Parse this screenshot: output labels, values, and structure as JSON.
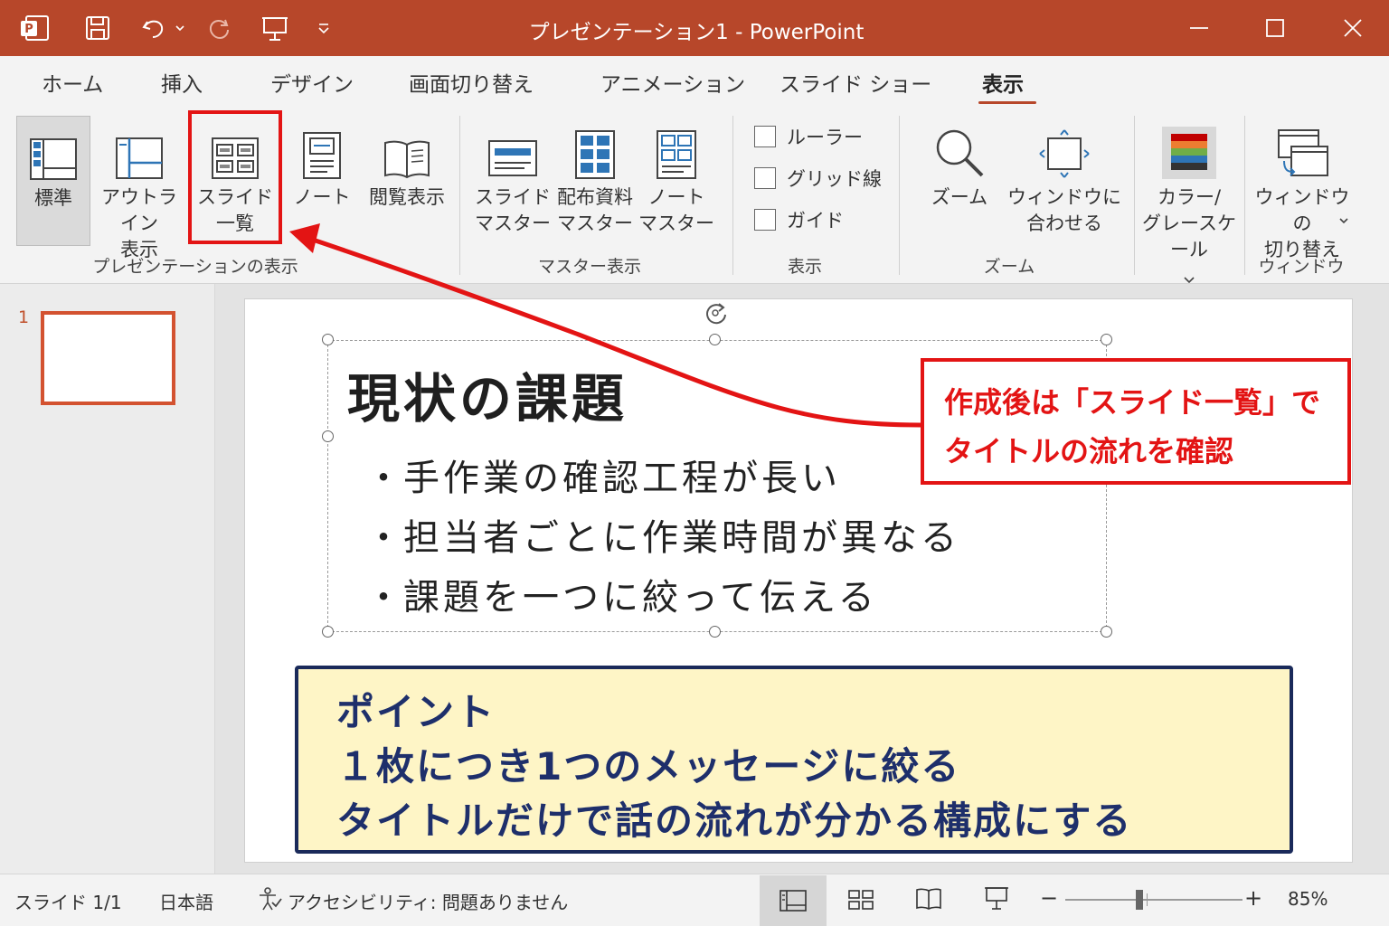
{
  "window": {
    "title": "プレゼンテーション1  -  PowerPoint"
  },
  "quick_access": {
    "icons": [
      "powerpoint-logo-icon",
      "save-icon",
      "undo-icon",
      "redo-icon",
      "present-from-start-icon",
      "customize-dropdown-icon"
    ]
  },
  "window_controls": [
    "minimize-icon",
    "maximize-icon",
    "close-icon"
  ],
  "tabs": [
    "ホーム",
    "挿入",
    "デザイン",
    "画面切り替え",
    "アニメーション",
    "スライド ショー",
    "表示"
  ],
  "active_tab": "表示",
  "ribbon": {
    "presentation_views": {
      "group_label": "プレゼンテーションの表示",
      "buttons": [
        {
          "label": "標準",
          "icon": "normal-view-icon",
          "selected": true
        },
        {
          "label": "アウトライン\n表示",
          "icon": "outline-view-icon"
        },
        {
          "label": "スライド\n一覧",
          "icon": "slide-sorter-icon"
        },
        {
          "label": "ノート",
          "icon": "notes-page-icon"
        },
        {
          "label": "閲覧表示",
          "icon": "reading-view-icon"
        }
      ]
    },
    "master_views": {
      "group_label": "マスター表示",
      "buttons": [
        {
          "label": "スライド\nマスター",
          "icon": "slide-master-icon"
        },
        {
          "label": "配布資料\nマスター",
          "icon": "handout-master-icon"
        },
        {
          "label": "ノート\nマスター",
          "icon": "notes-master-icon"
        }
      ]
    },
    "show": {
      "group_label": "表示",
      "checkboxes": [
        {
          "label": "ルーラー",
          "checked": false
        },
        {
          "label": "グリッド線",
          "checked": false
        },
        {
          "label": "ガイド",
          "checked": false
        }
      ]
    },
    "zoom": {
      "group_label": "ズーム",
      "buttons": [
        {
          "label": "ズーム",
          "icon": "zoom-magnifier-icon"
        },
        {
          "label": "ウィンドウに\n合わせる",
          "icon": "fit-to-window-icon"
        }
      ]
    },
    "color": {
      "buttons": [
        {
          "label": "カラー/\nグレースケール",
          "icon": "color-grayscale-icon"
        }
      ]
    },
    "window": {
      "group_label": "ウィンドウ",
      "buttons": [
        {
          "label": "ウィンドウの\n切り替え",
          "icon": "switch-windows-icon"
        }
      ]
    }
  },
  "thumbnails": [
    {
      "number": "1"
    }
  ],
  "slide": {
    "title": "現状の課題",
    "bullets": [
      "手作業の確認工程が長い",
      "担当者ごとに作業時間が異なる",
      "課題を一つに絞って伝える"
    ],
    "bullet_char": "・",
    "point_box": {
      "lines": [
        "ポイント",
        "１枚につき1つのメッセージに絞る",
        "タイトルだけで話の流れが分かる構成にする"
      ]
    }
  },
  "callout": {
    "lines": [
      "作成後は「スライド一覧」で",
      "タイトルの流れを確認"
    ],
    "color": "#e31414"
  },
  "status_bar": {
    "slide_counter": "スライド 1/1",
    "language": "日本語",
    "accessibility": "アクセシビリティ: 問題ありません",
    "zoom_percent": "85%",
    "zoom_minus": "−",
    "zoom_plus": "+",
    "zoom_level_percent": 85
  },
  "colors": {
    "accent": "#b7472a",
    "annotation_red": "#e31414",
    "point_box_bg": "#fef5c6",
    "point_box_border": "#1a2a5a"
  }
}
